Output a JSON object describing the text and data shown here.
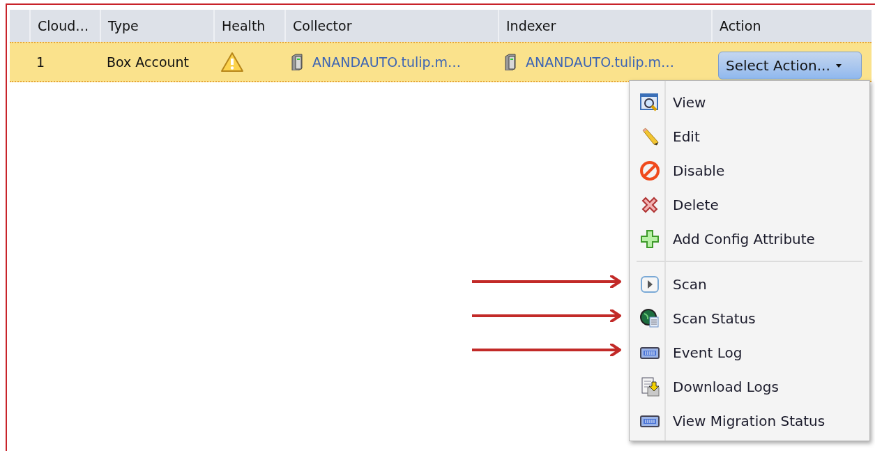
{
  "table": {
    "columns": [
      {
        "label": "Cloud…"
      },
      {
        "label": "Type"
      },
      {
        "label": "Health"
      },
      {
        "label": "Collector"
      },
      {
        "label": "Indexer"
      },
      {
        "label": "Action"
      }
    ],
    "rows": [
      {
        "selected": true,
        "number": "1",
        "type": "Box Account",
        "health_warning": true,
        "collector": "ANANDAUTO.tulip.m…",
        "indexer": "ANANDAUTO.tulip.m…",
        "action": "Select Action..."
      }
    ]
  },
  "action_menu": {
    "groups": [
      [
        {
          "label": "View",
          "marked": false
        },
        {
          "label": "Edit",
          "marked": false
        },
        {
          "label": "Disable",
          "marked": false
        },
        {
          "label": "Delete",
          "marked": false
        },
        {
          "label": "Add Config Attribute",
          "marked": false
        }
      ],
      [
        {
          "label": "Scan",
          "marked": true
        },
        {
          "label": "Scan Status",
          "marked": true
        },
        {
          "label": "Event Log",
          "marked": true
        },
        {
          "label": "Download Logs",
          "marked": false
        },
        {
          "label": "View Migration Status",
          "marked": false
        }
      ]
    ]
  }
}
